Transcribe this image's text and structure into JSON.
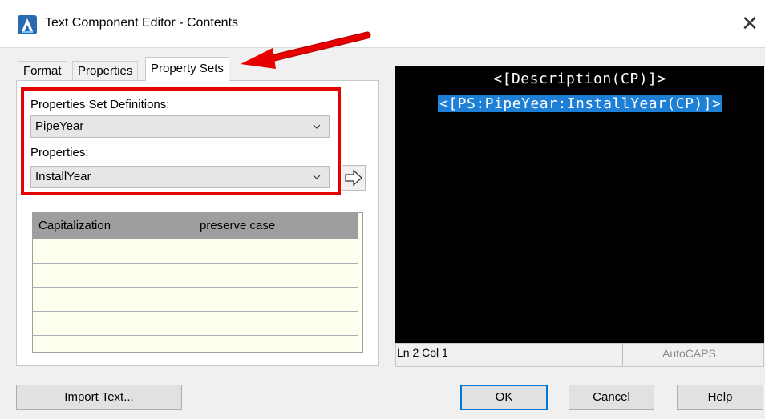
{
  "window": {
    "title": "Text Component Editor - Contents",
    "close_glyph": "✕"
  },
  "tabs": [
    {
      "label": "Format",
      "active": false
    },
    {
      "label": "Properties",
      "active": false
    },
    {
      "label": "Property Sets",
      "active": true
    }
  ],
  "property_sets": {
    "definitions_label": "Properties Set Definitions:",
    "definitions_value": "PipeYear",
    "properties_label": "Properties:",
    "properties_value": "InstallYear"
  },
  "grid": {
    "columns": [
      "Capitalization",
      "preserve case"
    ]
  },
  "preview": {
    "line1": "<[Description(CP)]>",
    "line2": "<[PS:PipeYear:InstallYear(CP)]>"
  },
  "status": {
    "position": "Ln 2 Col 1",
    "mode": "AutoCAPS"
  },
  "buttons": {
    "import": "Import Text...",
    "ok": "OK",
    "cancel": "Cancel",
    "help": "Help"
  },
  "icons": {
    "app": "autocad-a-icon",
    "insert_arrow": "right-arrow-icon",
    "dropdown": "chevron-down-icon"
  },
  "colors": {
    "highlight": "#e60000",
    "selection": "#1e7fd6",
    "preview_bg": "#000000",
    "ok_border": "#0078d7"
  }
}
